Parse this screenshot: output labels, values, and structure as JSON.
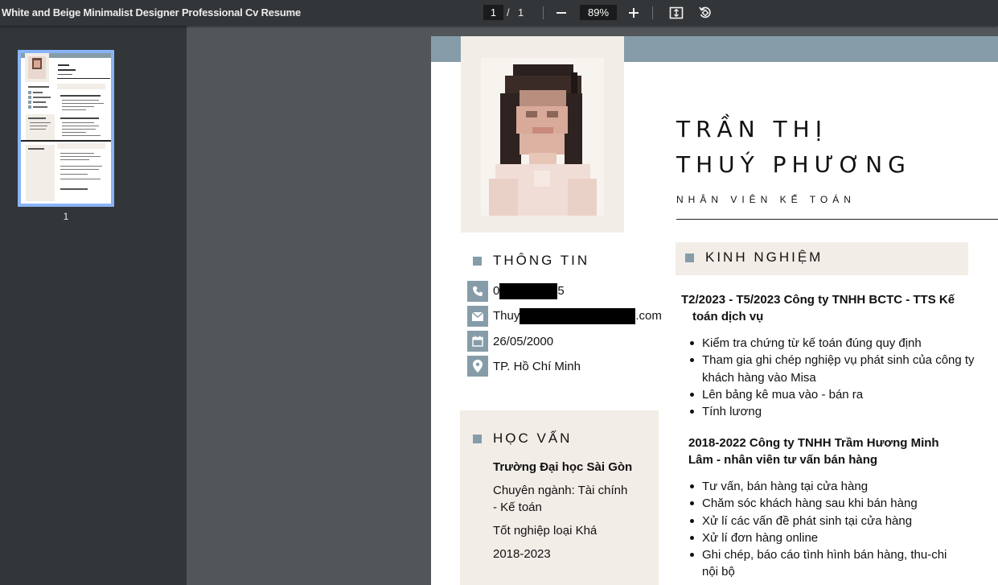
{
  "toolbar": {
    "title": "White and Beige Minimalist Designer Professional Cv Resume",
    "current_page": "1",
    "page_separator": "/",
    "total_pages": "1",
    "zoom": "89%"
  },
  "sidebar": {
    "thumbnail_label": "1"
  },
  "resume": {
    "name_line1": "TRẦN THỊ",
    "name_line2": "THUÝ PHƯƠNG",
    "job_title": "NHÂN VIÊN KẾ TOÁN",
    "info": {
      "heading": "THÔNG TIN",
      "phone_prefix": "0",
      "phone_suffix": "5",
      "email_prefix": "Thuy",
      "email_suffix": ".com",
      "birthday": "26/05/2000",
      "location": "TP. Hồ Chí Minh"
    },
    "education": {
      "heading": "HỌC VẤN",
      "school": "Trường Đại học Sài Gòn",
      "major_line1": "Chuyên ngành: Tài chính",
      "major_line2": "- Kế toán",
      "grade": "Tốt nghiệp loại Khá",
      "years": "2018-2023"
    },
    "experience": {
      "heading": "KINH NGHIỆM",
      "jobs": [
        {
          "title_line1": "T2/2023 - T5/2023 Công ty TNHH BCTC - TTS Kế",
          "title_line2": "toán dịch vụ",
          "bullets": [
            "Kiểm tra chứng từ kế toán đúng quy định",
            "Tham gia ghi chép nghiệp vụ phát sinh của công ty",
            "khách hàng vào Misa",
            "Lên bảng kê mua vào - bán ra",
            "Tính lương"
          ]
        },
        {
          "title_line1": "2018-2022 Công ty TNHH Trầm Hương Minh",
          "title_line2": "Lâm - nhân viên tư vấn bán hàng",
          "bullets": [
            "Tư vấn, bán hàng tại cửa hàng",
            "Chăm sóc khách hàng sau khi bán hàng",
            "Xử lí các vấn đề phát sinh tại cửa hàng",
            "Xử lí đơn hàng online",
            "Ghi chép, báo cáo tình hình bán hàng, thu-chi",
            "nội bộ"
          ]
        }
      ]
    }
  },
  "colors": {
    "accent": "#869da9",
    "beige": "#f2ede7",
    "toolbar_bg": "#323639",
    "viewer_bg": "#525659"
  }
}
